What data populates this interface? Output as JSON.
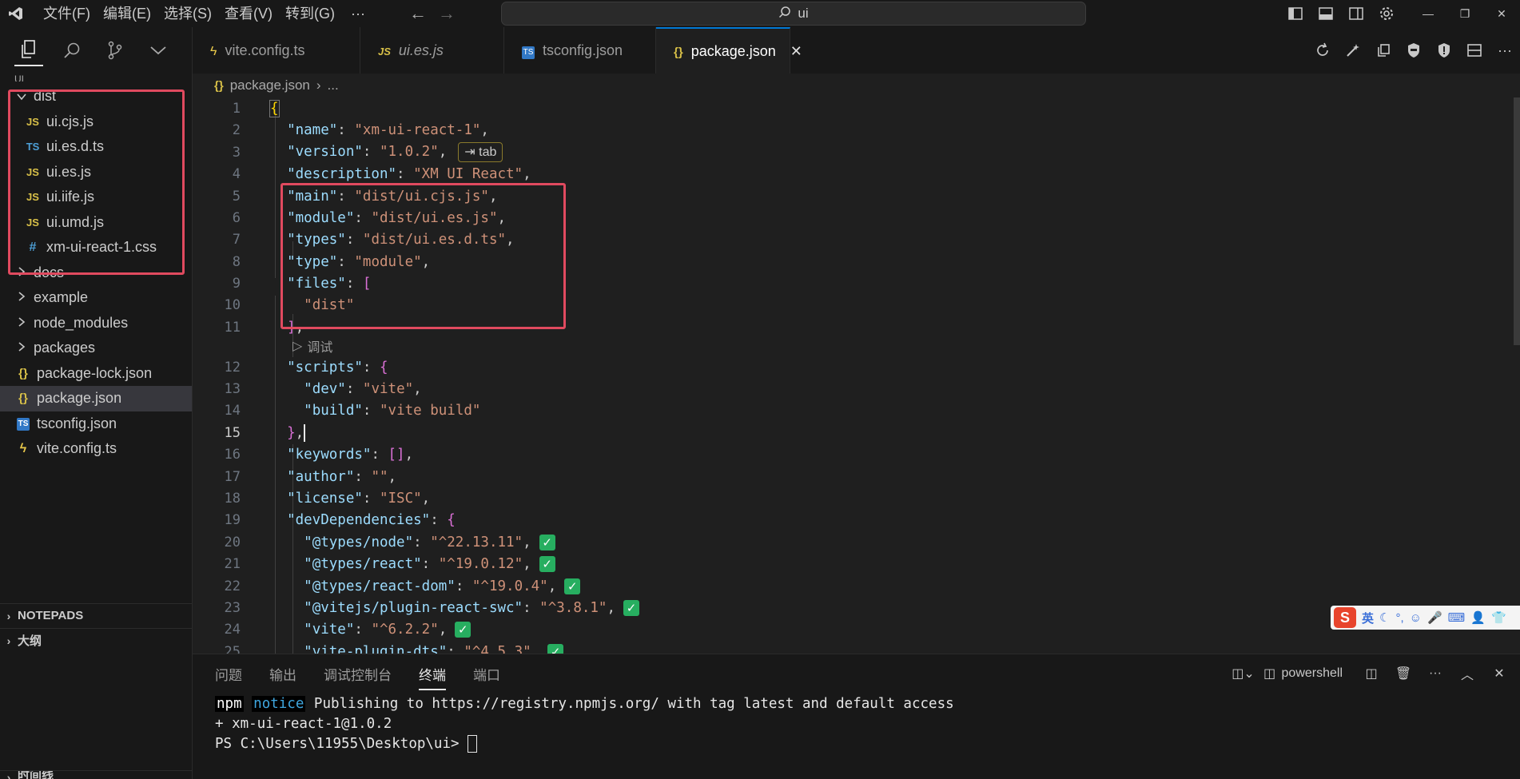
{
  "titlebar": {
    "menus": [
      "文件(F)",
      "编辑(E)",
      "选择(S)",
      "查看(V)",
      "转到(G)"
    ],
    "more": "···",
    "search_text": "ui"
  },
  "sidebar": {
    "root_label": "UI",
    "tree": [
      {
        "label": "dist",
        "kind": "folder-open",
        "indent": 0
      },
      {
        "label": "ui.cjs.js",
        "kind": "js",
        "indent": 1
      },
      {
        "label": "ui.es.d.ts",
        "kind": "ts",
        "indent": 1
      },
      {
        "label": "ui.es.js",
        "kind": "js",
        "indent": 1
      },
      {
        "label": "ui.iife.js",
        "kind": "js",
        "indent": 1
      },
      {
        "label": "ui.umd.js",
        "kind": "js",
        "indent": 1
      },
      {
        "label": "xm-ui-react-1.css",
        "kind": "css",
        "indent": 1
      },
      {
        "label": "docs",
        "kind": "folder",
        "indent": 0
      },
      {
        "label": "example",
        "kind": "folder",
        "indent": 0
      },
      {
        "label": "node_modules",
        "kind": "folder",
        "indent": 0
      },
      {
        "label": "packages",
        "kind": "folder",
        "indent": 0
      },
      {
        "label": "package-lock.json",
        "kind": "json",
        "indent": 0
      },
      {
        "label": "package.json",
        "kind": "json",
        "indent": 0,
        "selected": true
      },
      {
        "label": "tsconfig.json",
        "kind": "tsconfig",
        "indent": 0
      },
      {
        "label": "vite.config.ts",
        "kind": "vite",
        "indent": 0
      }
    ],
    "sections": [
      "NOTEPADS",
      "大纲",
      "时间线"
    ]
  },
  "tabs": [
    {
      "label": "vite.config.ts",
      "icon": "vite-icon"
    },
    {
      "label": "ui.es.js",
      "icon": "js-icon",
      "italic": true
    },
    {
      "label": "tsconfig.json",
      "icon": "tsconfig-icon"
    },
    {
      "label": "package.json",
      "icon": "json-icon",
      "active": true
    }
  ],
  "breadcrumb": {
    "file": "package.json",
    "rest": "..."
  },
  "editor": {
    "codelens": "调试",
    "tab_hint": "⇥ tab",
    "current_line": 15
  },
  "panel": {
    "tabs": [
      "问题",
      "输出",
      "调试控制台",
      "终端",
      "端口"
    ],
    "active_tab": "终端",
    "shell": "powershell",
    "terminal": {
      "line1_npm": "npm",
      "line1_notice": "notice",
      "line1_rest": " Publishing to https://registry.npmjs.org/ with tag latest and default access",
      "line2": "+ xm-ui-react-1@1.0.2",
      "line3": "PS C:\\Users\\11955\\Desktop\\ui> "
    }
  },
  "ime": {
    "lang": "英"
  }
}
